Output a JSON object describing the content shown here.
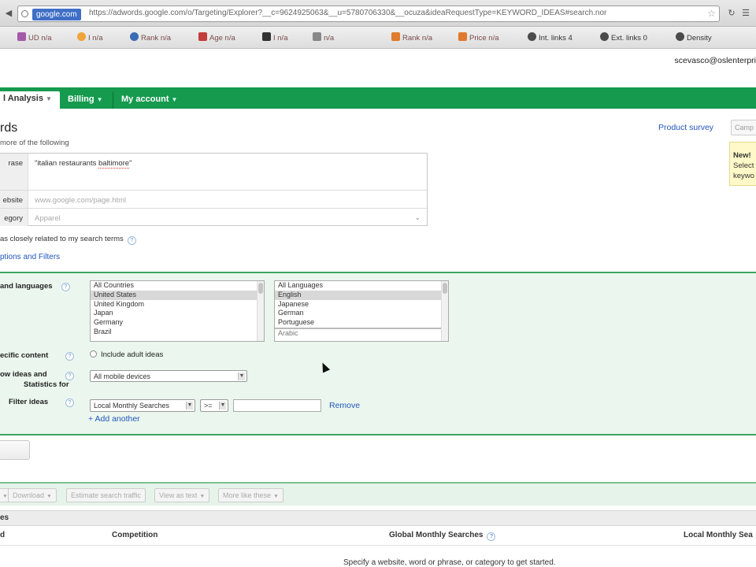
{
  "browser": {
    "url_host": "google.com",
    "url_text": "https://adwords.google.com/o/Targeting/Explorer?__c=9624925063&__u=5780706330&__ocuza&ideaRequestType=KEYWORD_IDEAS#search.nor",
    "seo_bar": [
      {
        "label": "UD n/a",
        "color": "#a55aa8"
      },
      {
        "label": "I n/a",
        "color": "#f0a43a"
      },
      {
        "label": "Rank n/a",
        "color": "#3a6bb5"
      },
      {
        "label": "Age n/a",
        "color": "#c43d3d"
      },
      {
        "label": "I n/a",
        "color": "#333333"
      },
      {
        "label": "n/a",
        "color": "#888888"
      },
      {
        "label": "Rank n/a",
        "color": "#e07a2e"
      },
      {
        "label": "Price n/a",
        "color": "#e07a2e"
      },
      {
        "label": "Int. links 4",
        "color": "#4b4b4b"
      },
      {
        "label": "Ext. links 0",
        "color": "#4b4b4b"
      },
      {
        "label": "Density",
        "color": "#4b4b4b"
      }
    ]
  },
  "header": {
    "user_email": "scevasco@oslenterpri"
  },
  "tabs": [
    {
      "label": "l Analysis",
      "active": true
    },
    {
      "label": "Billing",
      "active": false
    },
    {
      "label": "My account",
      "active": false
    }
  ],
  "page": {
    "title": "rds",
    "subtitle": "more of the following",
    "product_survey": "Product survey",
    "campaign_placeholder": "Camp",
    "new_callout": {
      "title": "New!",
      "line1": "Select",
      "line2": "keywo"
    }
  },
  "form": {
    "rows": [
      {
        "label": "rase",
        "value": "\"italian restaurants ",
        "value_underlined": "baltimore",
        "value_end": "\""
      },
      {
        "label": "ebsite",
        "placeholder": "www.google.com/page.html"
      },
      {
        "label": "egory",
        "placeholder": "Apparel"
      }
    ],
    "closely_related": "as closely related to my search terms",
    "advanced_link": "ptions and Filters"
  },
  "advanced": {
    "locations_label": "and languages",
    "countries": [
      "All Countries",
      "United States",
      "United Kingdom",
      "Japan",
      "Germany",
      "Brazil"
    ],
    "languages": [
      "All Languages",
      "English",
      "Japanese",
      "German",
      "Portuguese",
      "Arabic"
    ],
    "content_label": "ecific content",
    "adult_ideas": "Include adult ideas",
    "show_ideas_label_1": "ow ideas and",
    "show_ideas_label_2": "Statistics for",
    "device_value": "All mobile devices",
    "filter_label": "Filter ideas",
    "filter_metric": "Local Monthly Searches",
    "filter_operator": ">=",
    "remove": "Remove",
    "add_another": "+ Add another"
  },
  "results": {
    "toolbar": [
      {
        "label": "",
        "caret": true
      },
      {
        "label": "Download",
        "caret": true
      },
      {
        "label": "Estimate search traffic",
        "caret": false
      },
      {
        "label": "View as text",
        "caret": true
      },
      {
        "label": "More like these",
        "caret": true
      }
    ],
    "sub_label": "es",
    "columns": [
      "d",
      "Competition",
      "Global Monthly Searches",
      "Local Monthly Sea"
    ],
    "empty_message": "Specify a website, word or phrase, or category to get started."
  }
}
